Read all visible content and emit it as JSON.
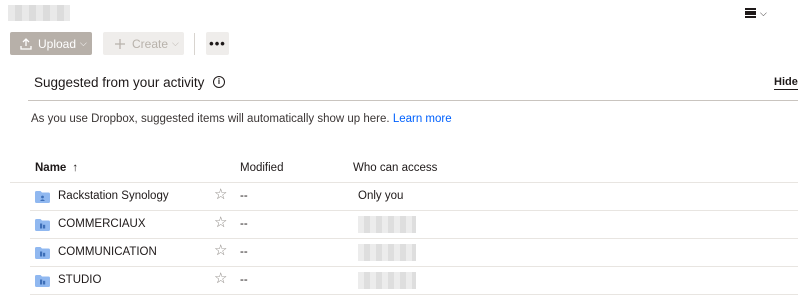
{
  "header": {
    "view_toggle_icon": "list-view-icon"
  },
  "toolbar": {
    "upload_label": "Upload",
    "create_label": "Create",
    "more_label": "•••"
  },
  "suggested": {
    "title": "Suggested from your activity",
    "info_icon": "i",
    "hide_label": "Hide",
    "description": "As you use Dropbox, suggested items will automatically show up here.",
    "learn_more": "Learn more"
  },
  "table": {
    "columns": {
      "name": "Name",
      "sort_arrow": "↑",
      "modified": "Modified",
      "access": "Who can access"
    },
    "rows": [
      {
        "name": "Rackstation Synology",
        "modified": "--",
        "access": "Only you",
        "folder_type": "shared-folder",
        "access_blurred": false
      },
      {
        "name": "COMMERCIAUX",
        "modified": "--",
        "access": "",
        "folder_type": "team-folder",
        "access_blurred": true
      },
      {
        "name": "COMMUNICATION",
        "modified": "--",
        "access": "",
        "folder_type": "team-folder",
        "access_blurred": true
      },
      {
        "name": "STUDIO",
        "modified": "--",
        "access": "",
        "folder_type": "team-folder",
        "access_blurred": true
      }
    ]
  },
  "colors": {
    "upload_bg": "#b7b0a9",
    "create_bg": "#efedeb",
    "link": "#0061fe",
    "folder": "#90b8f0"
  }
}
